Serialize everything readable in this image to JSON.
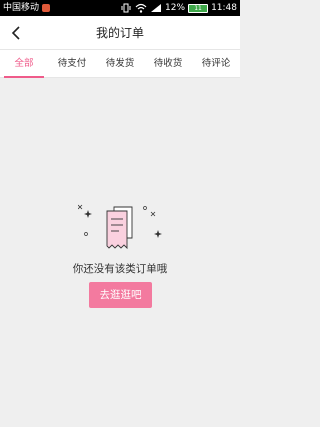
{
  "status_bar": {
    "carrier": "中国移动",
    "battery_percent": "12%",
    "battery_label": "11",
    "time": "11:48"
  },
  "header": {
    "title": "我的订单",
    "back_icon": "chevron-left-icon"
  },
  "tabs": [
    {
      "label": "全部",
      "active": true
    },
    {
      "label": "待支付",
      "active": false
    },
    {
      "label": "待发货",
      "active": false
    },
    {
      "label": "待收货",
      "active": false
    },
    {
      "label": "待评论",
      "active": false
    }
  ],
  "empty_state": {
    "icon": "empty-orders-icon",
    "message": "你还没有该类订单哦",
    "action_label": "去逛逛吧"
  },
  "colors": {
    "accent": "#ef5b8a",
    "button": "#f37a9f",
    "background": "#efefef"
  }
}
